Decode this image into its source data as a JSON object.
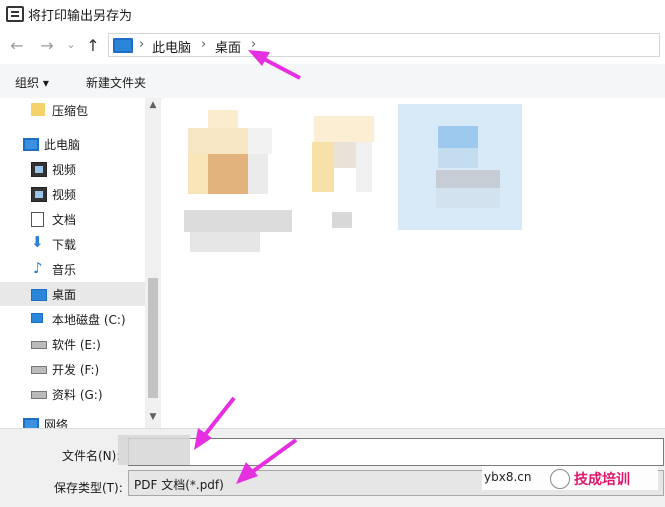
{
  "window": {
    "title": "将打印输出另存为"
  },
  "nav": {
    "back": "←",
    "forward": "→",
    "recent": "⌄",
    "up": "↑"
  },
  "address": {
    "crumbs": [
      "此电脑",
      "桌面"
    ],
    "separator": "›"
  },
  "toolbar": {
    "organize_label": "组织 ▾",
    "new_folder_label": "新建文件夹"
  },
  "sidebar": {
    "items": [
      {
        "label": "压缩包",
        "icon": "folder-icon"
      },
      {
        "label": "此电脑",
        "icon": "pc-icon"
      },
      {
        "label": "视频",
        "icon": "video-icon"
      },
      {
        "label": "视频",
        "icon": "video-icon"
      },
      {
        "label": "文档",
        "icon": "document-icon"
      },
      {
        "label": "下载",
        "icon": "download-arrow-icon"
      },
      {
        "label": "音乐",
        "icon": "music-note-icon"
      },
      {
        "label": "桌面",
        "icon": "desktop-icon"
      },
      {
        "label": "本地磁盘 (C:)",
        "icon": "drive-c-icon"
      },
      {
        "label": "软件 (E:)",
        "icon": "drive-icon"
      },
      {
        "label": "开发 (F:)",
        "icon": "drive-icon"
      },
      {
        "label": "资料 (G:)",
        "icon": "drive-icon"
      },
      {
        "label": "网络",
        "icon": "network-icon"
      }
    ],
    "scroll_up": "▲",
    "scroll_down": "▼"
  },
  "bottom": {
    "filename_label": "文件名(N):",
    "filename_value": "",
    "savetype_label": "保存类型(T):",
    "savetype_value": "PDF 文档(*.pdf)"
  },
  "watermark": {
    "url": "ybx8.cn",
    "brand": "技成培训"
  },
  "colors": {
    "accent": "#2b86d9",
    "selected_bg": "#cce8ff",
    "annotation": "#e52fe0"
  }
}
